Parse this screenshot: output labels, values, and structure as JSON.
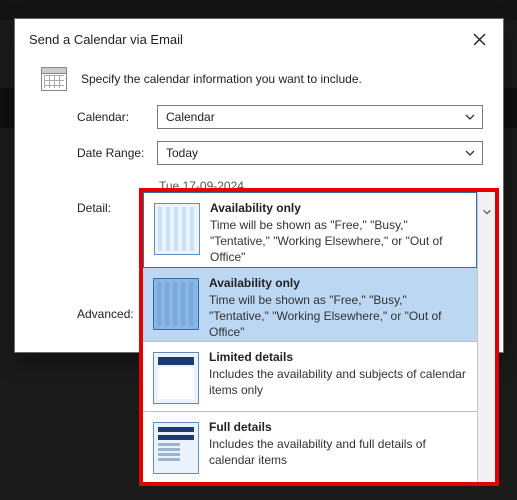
{
  "dialog": {
    "title": "Send a Calendar via Email",
    "intro": "Specify the calendar information you want to include."
  },
  "labels": {
    "calendar": "Calendar:",
    "date_range": "Date Range:",
    "detail": "Detail:",
    "advanced": "Advanced:"
  },
  "fields": {
    "calendar_value": "Calendar",
    "date_range_value": "Today",
    "date_hint": "Tue 17-09-2024"
  },
  "detail_options": [
    {
      "title": "Availability only",
      "desc": "Time will be shown as \"Free,\" \"Busy,\" \"Tentative,\" \"Working Elsewhere,\" or \"Out of Office\"",
      "state": "focused",
      "thumb": "avail"
    },
    {
      "title": "Availability only",
      "desc": "Time will be shown as \"Free,\" \"Busy,\" \"Tentative,\" \"Working Elsewhere,\" or \"Out of Office\"",
      "state": "selected",
      "thumb": "avail sel"
    },
    {
      "title": "Limited details",
      "desc": "Includes the availability and subjects of calendar items only",
      "state": "",
      "thumb": "limited"
    },
    {
      "title": "Full details",
      "desc": "Includes the availability and full details of calendar items",
      "state": "",
      "thumb": "full"
    }
  ]
}
